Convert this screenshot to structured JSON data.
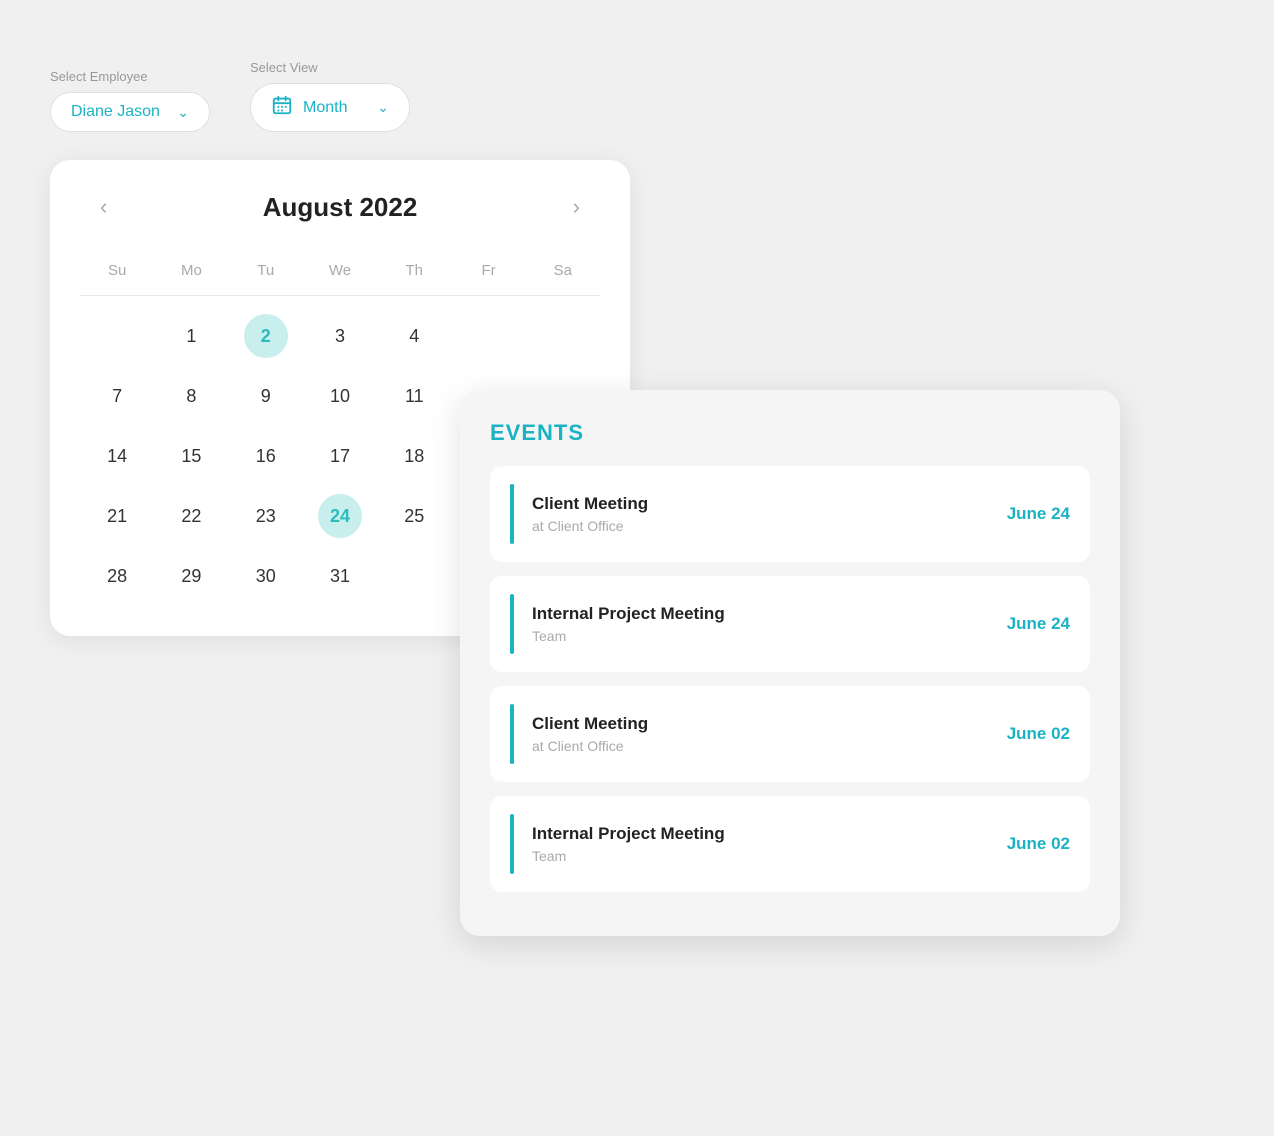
{
  "controls": {
    "employee_label": "Select Employee",
    "employee_value": "Diane Jason",
    "view_label": "Select View",
    "view_value": "Month"
  },
  "calendar": {
    "month_title": "August 2022",
    "day_headers": [
      "Su",
      "Mo",
      "Tu",
      "We",
      "Th",
      "Fr",
      "Sa"
    ],
    "weeks": [
      [
        "",
        "1",
        "2",
        "3",
        "4",
        "",
        ""
      ],
      [
        "7",
        "8",
        "9",
        "10",
        "11",
        "",
        ""
      ],
      [
        "14",
        "15",
        "16",
        "17",
        "18",
        "",
        ""
      ],
      [
        "21",
        "22",
        "23",
        "24",
        "25",
        "",
        ""
      ],
      [
        "28",
        "29",
        "30",
        "31",
        "",
        "",
        ""
      ]
    ],
    "highlighted_days": [
      "2",
      "24"
    ]
  },
  "events": {
    "title": "EVENTS",
    "items": [
      {
        "name": "Client Meeting",
        "location": "at Client Office",
        "date": "June 24"
      },
      {
        "name": "Internal Project Meeting",
        "location": "Team",
        "date": "June 24"
      },
      {
        "name": "Client Meeting",
        "location": "at Client Office",
        "date": "June 02"
      },
      {
        "name": "Internal Project Meeting",
        "location": "Team",
        "date": "June 02"
      }
    ]
  }
}
